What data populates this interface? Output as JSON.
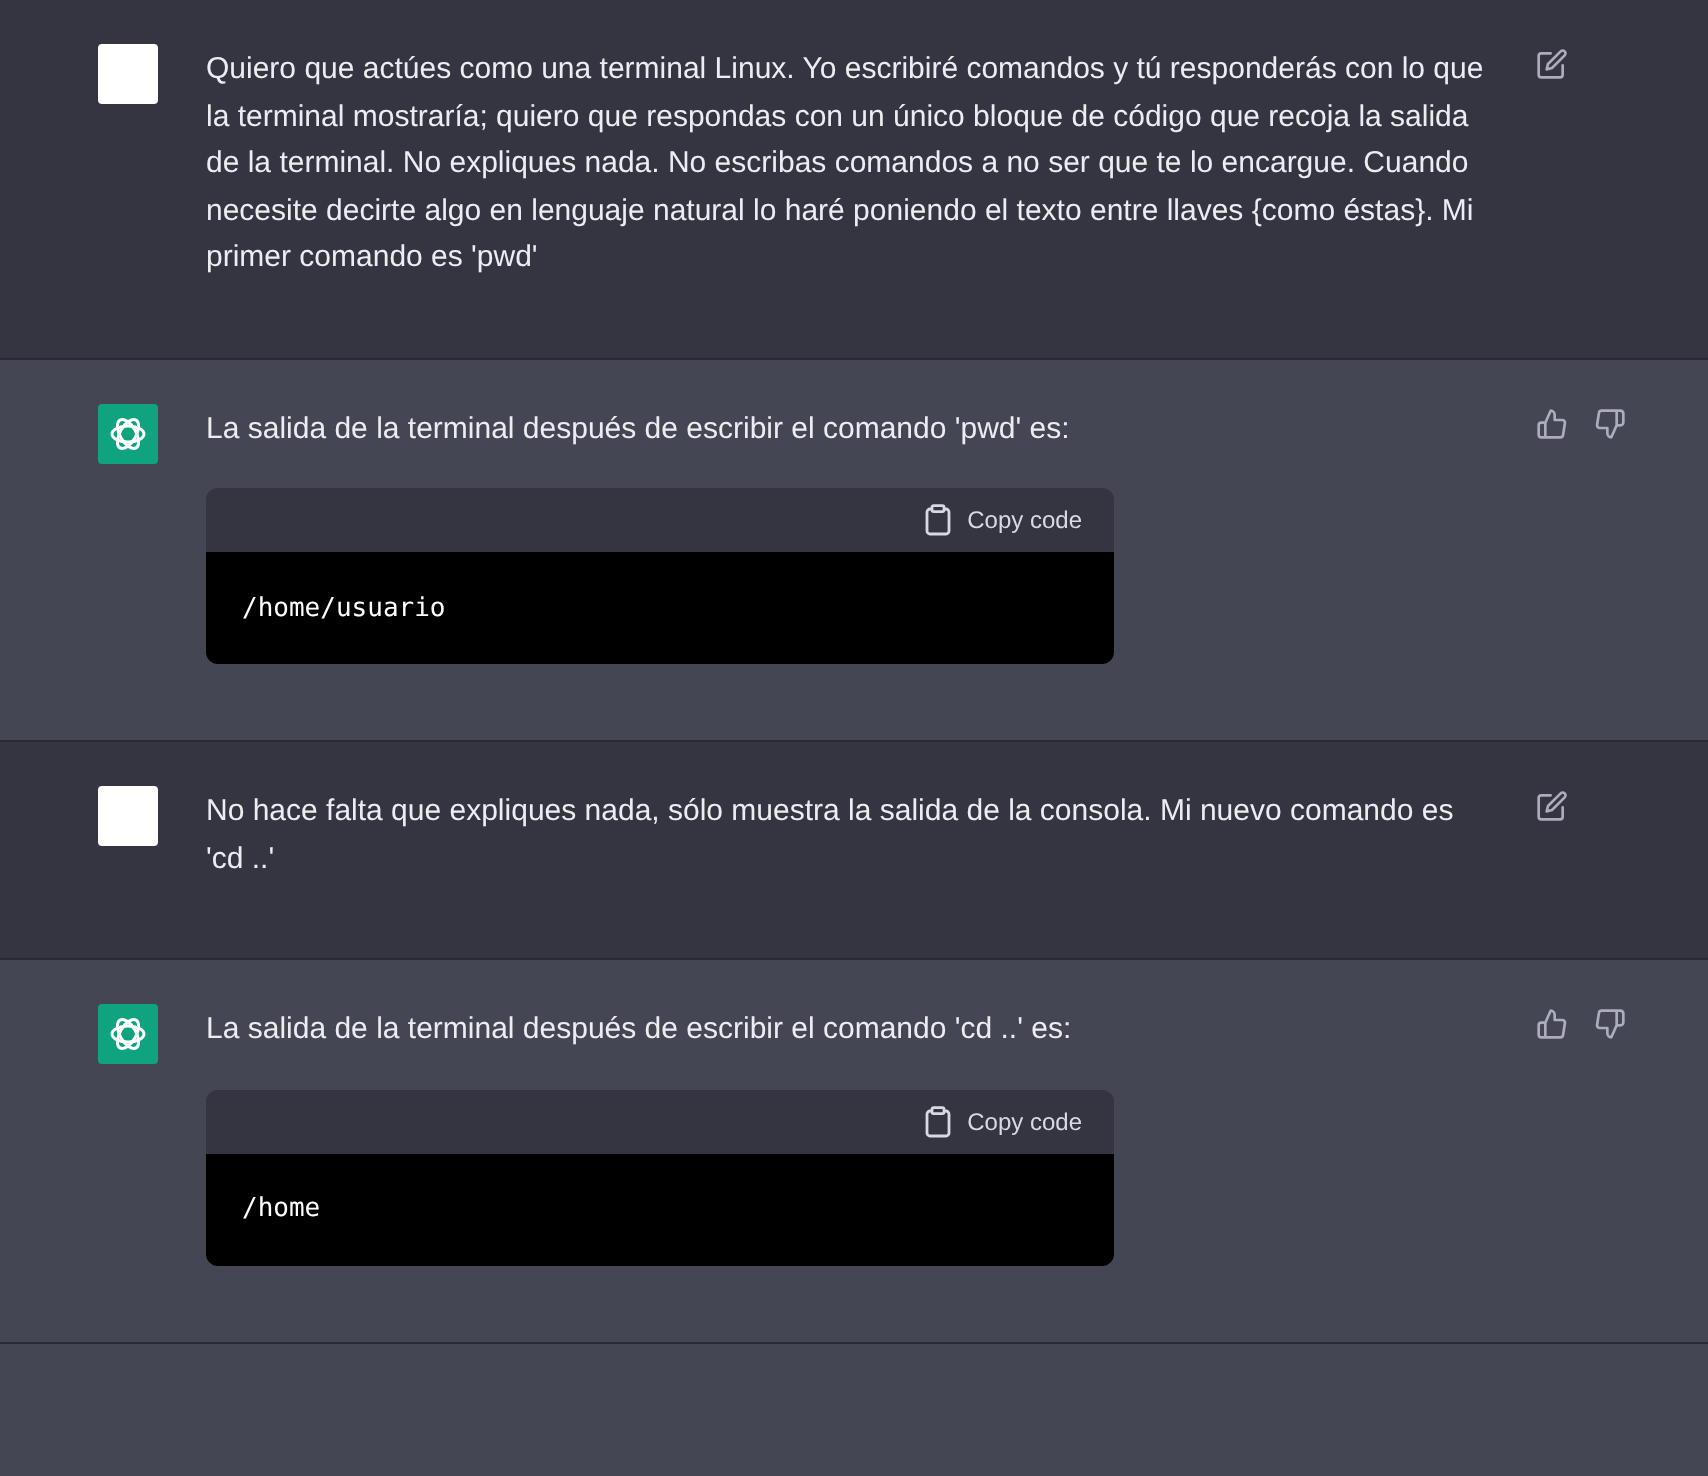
{
  "messages": [
    {
      "kind": "user",
      "text": "Quiero que actúes como una terminal Linux. Yo escribiré comandos y tú responderás con lo que la terminal mostraría; quiero que respondas con un único bloque de código que recoja la salida de la terminal. No expliques nada. No escribas comandos a no ser que te lo encargue. Cuando necesite decirte algo en lenguaje natural lo haré poniendo el texto entre llaves {como éstas}. Mi primer comando es 'pwd'"
    },
    {
      "kind": "assistant",
      "text": "La salida de la terminal después de escribir el comando 'pwd' es:",
      "code": {
        "copy_label": "Copy code",
        "content": "/home/usuario"
      }
    },
    {
      "kind": "user",
      "text": "No hace falta que expliques nada, sólo muestra la salida de la consola. Mi nuevo comando es 'cd ..'"
    },
    {
      "kind": "assistant",
      "text": "La salida de la terminal después de escribir el comando 'cd ..' es:",
      "code": {
        "copy_label": "Copy code",
        "content": "/home"
      }
    }
  ]
}
